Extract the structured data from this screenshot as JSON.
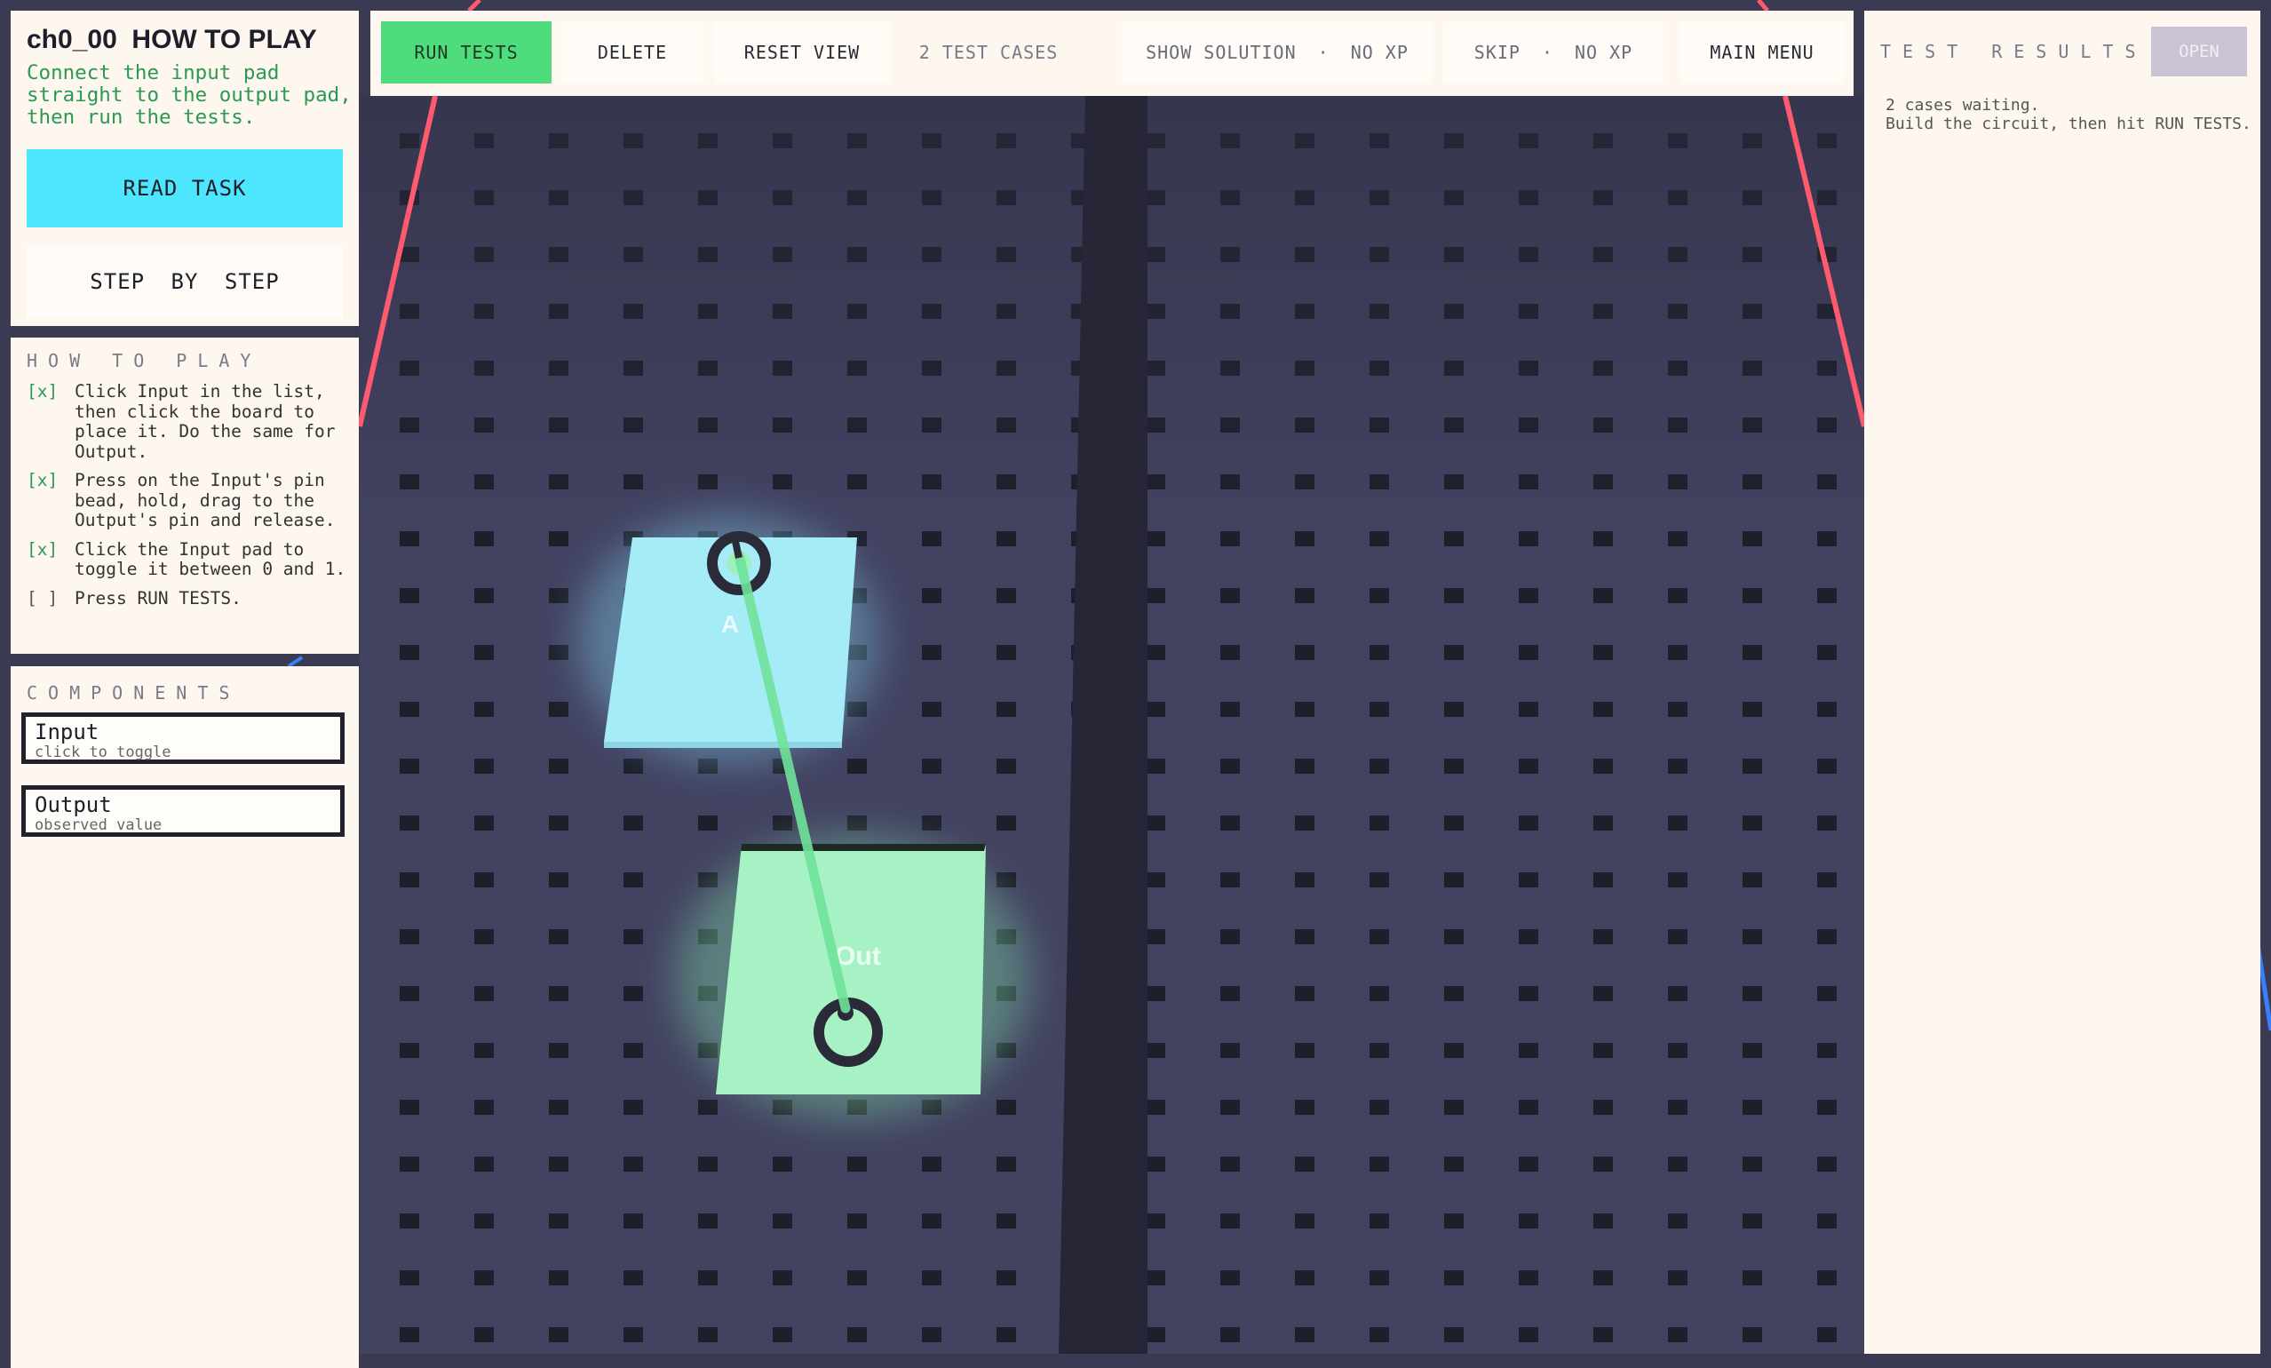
{
  "task": {
    "title": "ch0_00  HOW TO PLAY",
    "description": "Connect the input pad straight to the output pad, then run the tests.",
    "read_task_label": "READ TASK",
    "step_by_step_label": "STEP BY STEP"
  },
  "how_to_play": {
    "heading": "HOW TO PLAY",
    "steps": [
      {
        "mark": "[x]",
        "text": "Click Input in the list, then click the board to place it. Do the same for Output."
      },
      {
        "mark": "[x]",
        "text": "Press on the Input's pin bead, hold, drag to the Output's pin and release."
      },
      {
        "mark": "[x]",
        "text": "Click the Input pad to toggle it between 0 and 1."
      },
      {
        "mark": "[ ]",
        "text": "Press RUN TESTS."
      }
    ]
  },
  "components": {
    "heading": "COMPONENTS",
    "items": [
      {
        "name": "Input",
        "sub": "click to toggle"
      },
      {
        "name": "Output",
        "sub": "observed value"
      }
    ]
  },
  "toolbar": {
    "run_tests": "RUN TESTS",
    "delete": "DELETE",
    "reset_view": "RESET VIEW",
    "test_cases": "2 TEST CASES",
    "show_solution": "SHOW SOLUTION",
    "show_solution_xp": "NO XP",
    "skip": "SKIP",
    "skip_xp": "NO XP",
    "separator": "·",
    "main_menu": "MAIN MENU"
  },
  "results": {
    "heading": "TEST RESULTS",
    "open_label": "OPEN",
    "line1": "2 cases waiting.",
    "line2": "Build the circuit, then hit RUN TESTS."
  },
  "board": {
    "input_pad_label": "A",
    "output_pad_label": "Out",
    "colors": {
      "board": "#3a3a52",
      "input_pad": "#a6ecf7",
      "output_pad": "#a6f2c4",
      "wire": "#6fe39a",
      "rail": "#ff5a6e",
      "run_button": "#4fdc7c",
      "read_task_button": "#4de6ff"
    }
  }
}
